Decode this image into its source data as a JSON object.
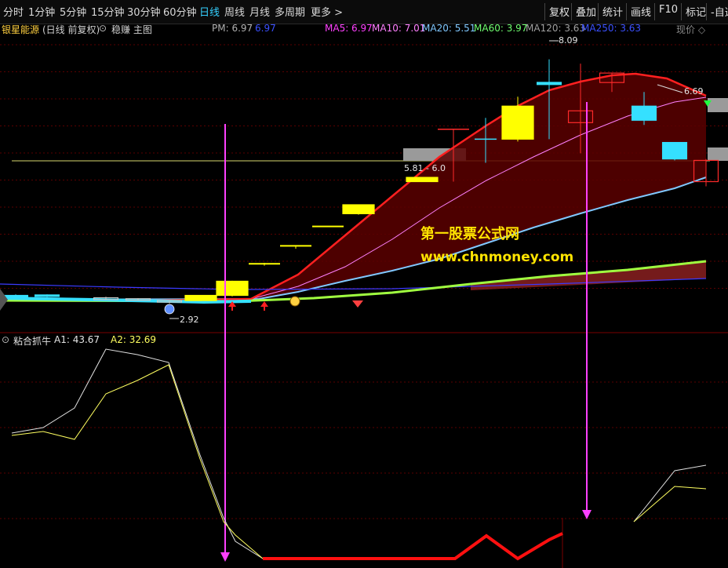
{
  "toolbar": {
    "periods": [
      "分时",
      "1分钟",
      "5分钟",
      "15分钟",
      "30分钟",
      "60分钟",
      "日线",
      "周线",
      "月线",
      "多周期",
      "更多 >"
    ],
    "active_period": "日线",
    "right": [
      "复权",
      "叠加",
      "统计",
      "画线",
      "F10",
      "标记",
      "-自选"
    ]
  },
  "header": {
    "stock_name": "银星能源",
    "mode": "(日线 前复权)",
    "strategy": "稳赚 主图",
    "pm_label": "PM: 6.97",
    "pm_value": "6.97",
    "ma5": "MA5: 6.97",
    "ma10": "MA10: 7.01",
    "ma20": "MA20: 5.51",
    "ma60": "MA60: 3.97",
    "ma120": "MA120: 3.63",
    "ma250": "MA250: 3.63",
    "price_mode": "现价 ◇"
  },
  "annotations": {
    "high": "8.09",
    "low": "2.92",
    "right_value": "6.69",
    "zone_label": "5.81 - 6.0"
  },
  "subheader": {
    "name": "粘合抓牛",
    "a1": "A1: 43.67",
    "a2": "A2: 32.69"
  },
  "watermark": {
    "line1": "第一股票公式网",
    "line2": "www.chnmoney.com"
  },
  "colors": {
    "bg": "#000000",
    "up": "#ff2a2a",
    "flat_up": "#ffff00",
    "down": "#35e0ff",
    "ma5": "#ff40ff",
    "ma10": "#ff80ff",
    "ma20": "#80c8ff",
    "ma60": "#70ff70",
    "ma120": "#a0a0a0",
    "ma250": "#3a3aff",
    "signal": "#ff40ff",
    "accent": "#35d0ff"
  },
  "chart_data": [
    {
      "type": "candlestick",
      "candles": [
        {
          "x": 20,
          "open": 3.05,
          "close": 3.09,
          "high": 3.11,
          "low": 3.03,
          "color": "cyan"
        },
        {
          "x": 60,
          "open": 3.07,
          "close": 3.1,
          "high": 3.11,
          "low": 3.05,
          "color": "cyan"
        },
        {
          "x": 135,
          "open": 3.04,
          "close": 3.0,
          "high": 3.06,
          "low": 2.99,
          "color": "hollow"
        },
        {
          "x": 176,
          "open": 3.02,
          "close": 2.99,
          "high": 3.03,
          "low": 2.98,
          "color": "hollow"
        },
        {
          "x": 216,
          "open": 2.98,
          "close": 2.95,
          "high": 2.99,
          "low": 2.92,
          "color": "hollow"
        },
        {
          "x": 256,
          "open": 2.98,
          "close": 3.09,
          "high": 3.09,
          "low": 2.97,
          "color": "yellow"
        },
        {
          "x": 296,
          "open": 3.09,
          "close": 3.39,
          "high": 3.4,
          "low": 3.07,
          "color": "yellow"
        },
        {
          "x": 337,
          "open": 3.76,
          "close": 3.76,
          "high": 3.78,
          "low": 3.72,
          "color": "yellow"
        },
        {
          "x": 377,
          "open": 4.12,
          "close": 4.14,
          "high": 4.14,
          "low": 4.08,
          "color": "yellow"
        },
        {
          "x": 418,
          "open": 4.55,
          "close": 4.55,
          "high": 4.55,
          "low": 4.55,
          "color": "yellow"
        },
        {
          "x": 457,
          "open": 4.82,
          "close": 5.01,
          "high": 5.01,
          "low": 4.8,
          "color": "yellow"
        },
        {
          "x": 538,
          "open": 5.59,
          "close": 5.5,
          "high": 5.59,
          "low": 5.5,
          "color": "yellow"
        },
        {
          "x": 578,
          "open": 6.61,
          "close": 6.61,
          "high": 6.61,
          "low": 5.5,
          "color": "red-line"
        },
        {
          "x": 619,
          "open": 6.4,
          "close": 6.4,
          "high": 6.85,
          "low": 5.9,
          "color": "cyan-cross"
        },
        {
          "x": 660,
          "open": 6.4,
          "close": 7.1,
          "high": 7.3,
          "low": 6.35,
          "color": "yellow"
        },
        {
          "x": 700,
          "open": 7.58,
          "close": 7.58,
          "high": 8.09,
          "low": 6.4,
          "color": "cyan-flat"
        },
        {
          "x": 740,
          "open": 6.75,
          "close": 7.0,
          "high": 8.0,
          "low": 6.1,
          "color": "hollow-red"
        },
        {
          "x": 780,
          "open": 7.6,
          "close": 7.8,
          "high": 7.8,
          "low": 7.4,
          "color": "hollow-red"
        },
        {
          "x": 821,
          "open": 7.1,
          "close": 6.8,
          "high": 7.4,
          "low": 6.7,
          "color": "cyan"
        },
        {
          "x": 860,
          "open": 5.98,
          "close": 6.33,
          "high": 6.33,
          "low": 5.95,
          "color": "cyan"
        },
        {
          "x": 900,
          "open": 5.95,
          "close": 5.5,
          "high": 5.98,
          "low": 5.4,
          "color": "hollow-red"
        }
      ],
      "ylim": [
        2.5,
        8.6
      ]
    },
    {
      "type": "line",
      "title": "粘合抓牛",
      "series": [
        {
          "name": "A1",
          "values": [
            46,
            42,
            50,
            50,
            49,
            70,
            70,
            65,
            55,
            40,
            30,
            10,
            0,
            0,
            0,
            0,
            0,
            0,
            0,
            0,
            5,
            20
          ]
        },
        {
          "name": "A2",
          "values": [
            45,
            41,
            49,
            49,
            49,
            69,
            69,
            64,
            53,
            38,
            28,
            8,
            0,
            0,
            0,
            0,
            0,
            0,
            0,
            0,
            3,
            15
          ]
        }
      ],
      "ylim": [
        0,
        100
      ]
    }
  ]
}
